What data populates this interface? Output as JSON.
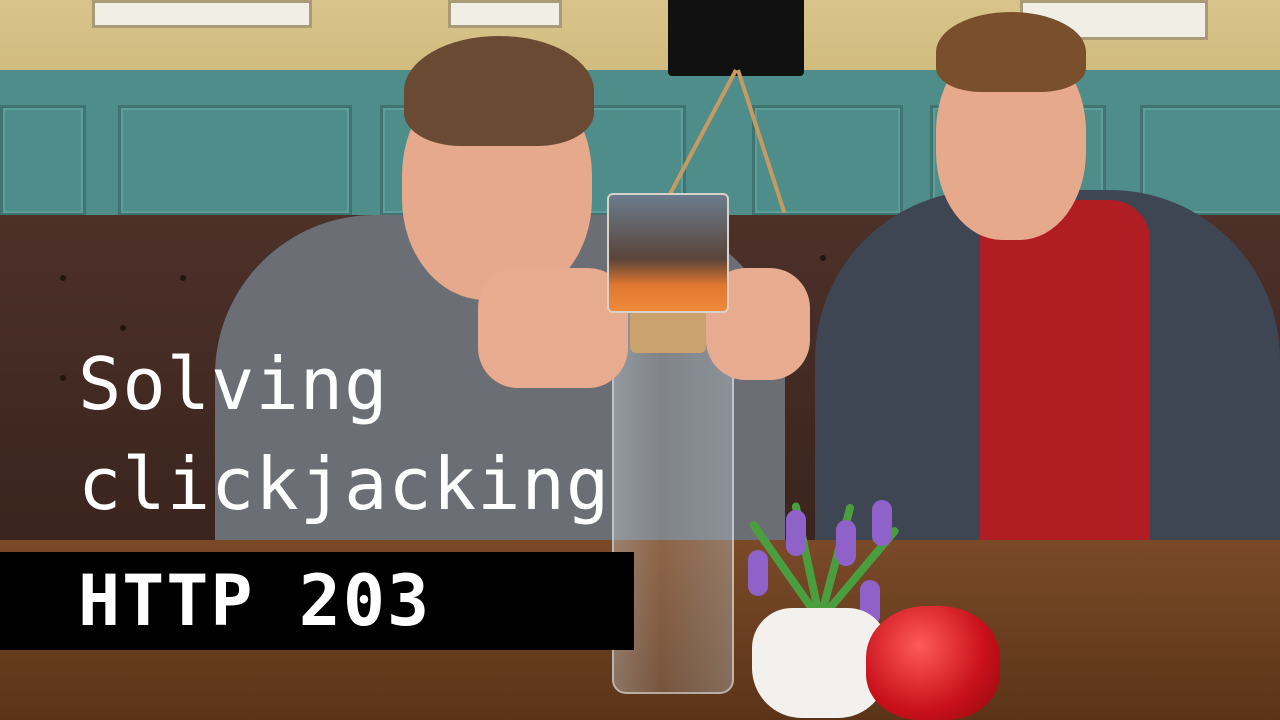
{
  "caption": {
    "title_line_1": "Solving",
    "title_line_2": "clickjacking",
    "series_label": "HTTP 203"
  },
  "colors": {
    "banner_background": "#000000",
    "caption_text": "#ffffff",
    "wall_teal": "#4f8d8a",
    "sofa_brown": "#3a241d",
    "table_wood": "#6a3e20"
  }
}
